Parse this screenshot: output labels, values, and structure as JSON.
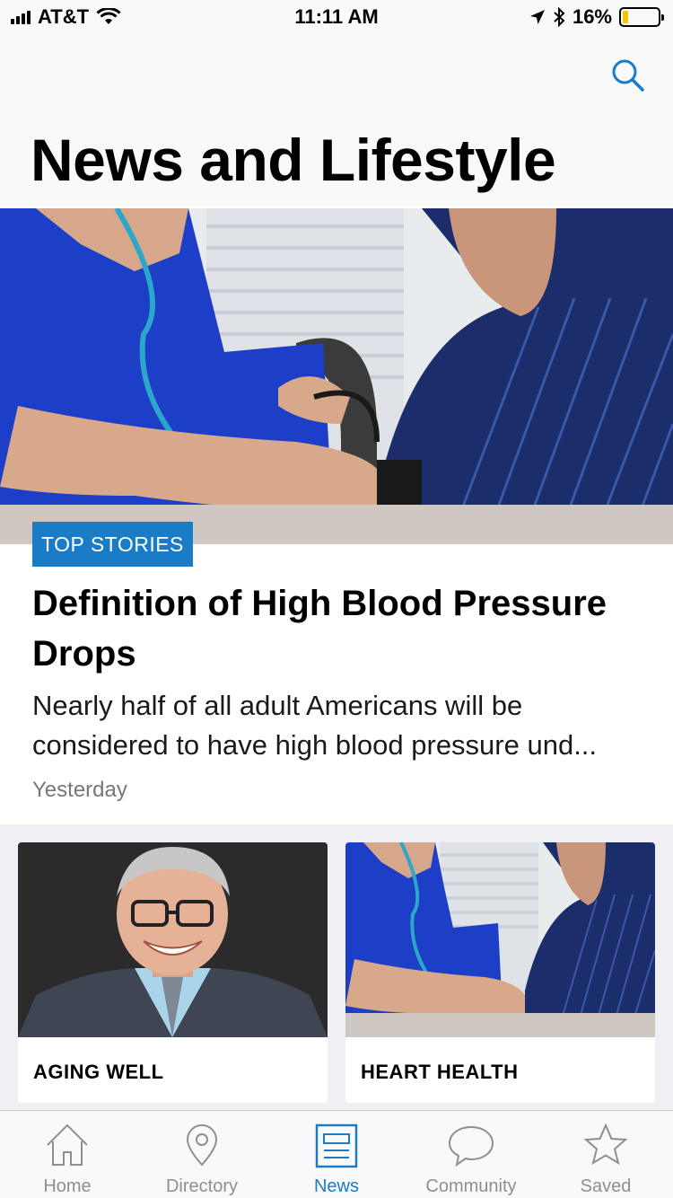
{
  "status_bar": {
    "carrier": "AT&T",
    "time": "11:11 AM",
    "battery_percent": "16%",
    "battery_level": 0.16
  },
  "header": {
    "title": "News and Lifestyle",
    "search_icon": "search-icon"
  },
  "featured": {
    "tag": "TOP STORIES",
    "headline": "Definition of High Blood Pressure Drops",
    "summary": "Nearly half of all adult Americans will be considered to have high blood pressure und...",
    "date": "Yesterday"
  },
  "cards": [
    {
      "label": "AGING WELL"
    },
    {
      "label": "HEART HEALTH"
    }
  ],
  "tab_bar": {
    "active_color": "#1a7cc7",
    "inactive_color": "#8e8e93",
    "tabs": [
      {
        "label": "Home",
        "icon": "home-icon"
      },
      {
        "label": "Directory",
        "icon": "location-pin-icon"
      },
      {
        "label": "News",
        "icon": "newspaper-icon",
        "active": true
      },
      {
        "label": "Community",
        "icon": "speech-bubble-icon"
      },
      {
        "label": "Saved",
        "icon": "star-icon"
      }
    ]
  }
}
